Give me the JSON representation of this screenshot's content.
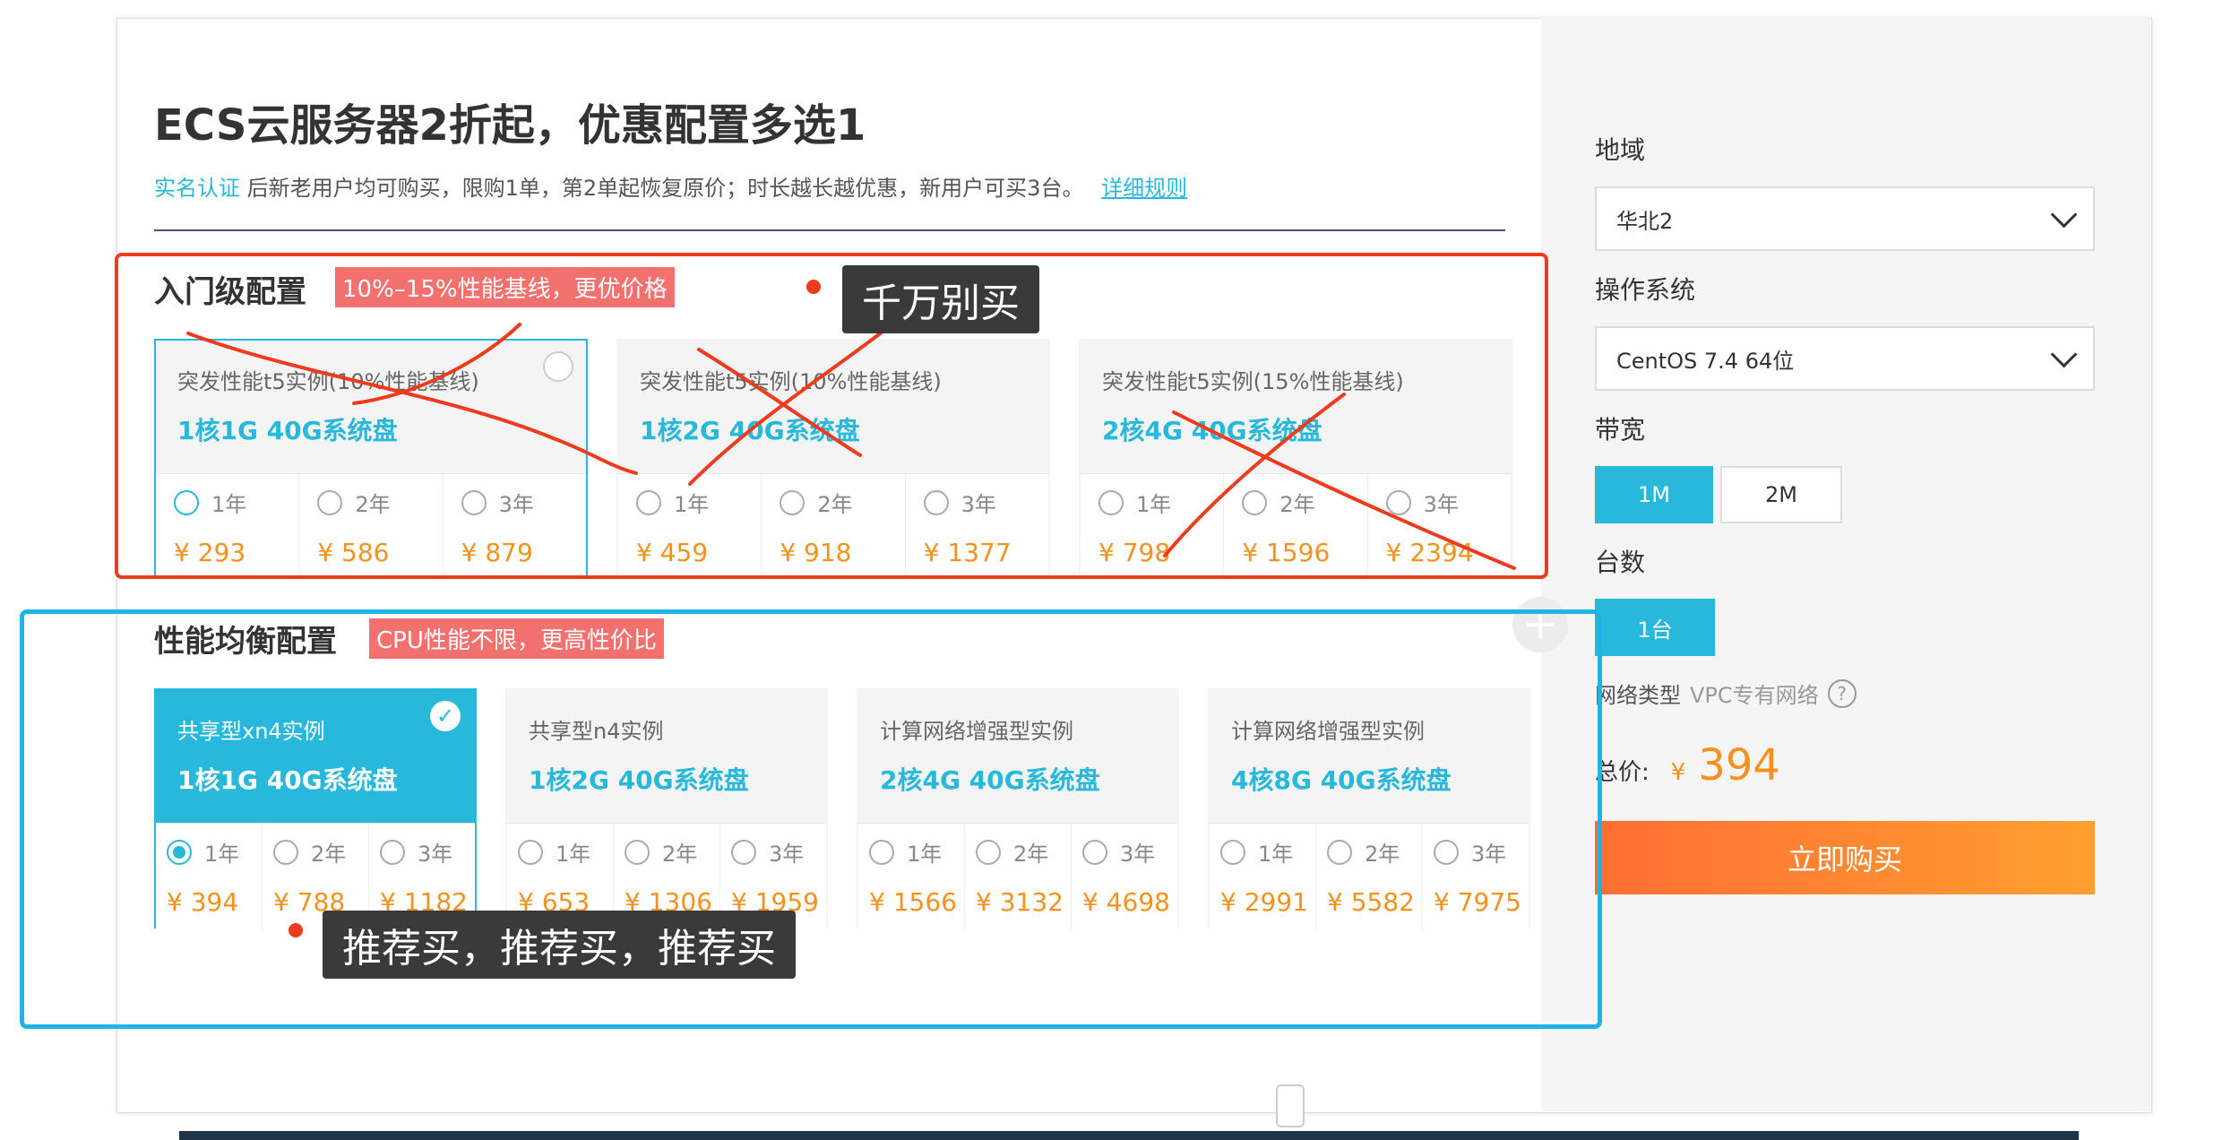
{
  "header": {
    "title": "ECS云服务器2折起，优惠配置多选1",
    "sub_blue": "实名认证",
    "sub_text": "后新老用户均可购买，限购1单，第2单起恢复原价；时长越长越优惠，新用户可买3台。",
    "sub_link": "详细规则"
  },
  "entry": {
    "title": "入门级配置",
    "badge": "10%–15%性能基线，更优价格",
    "plans": [
      {
        "name": "突发性能t5实例(10%性能基线)",
        "spec": "1核1G 40G系统盘",
        "opts": [
          {
            "y": "1年",
            "p": "¥ 293"
          },
          {
            "y": "2年",
            "p": "¥ 586"
          },
          {
            "y": "3年",
            "p": "¥ 879"
          }
        ]
      },
      {
        "name": "突发性能t5实例(10%性能基线)",
        "spec": "1核2G 40G系统盘",
        "opts": [
          {
            "y": "1年",
            "p": "¥ 459"
          },
          {
            "y": "2年",
            "p": "¥ 918"
          },
          {
            "y": "3年",
            "p": "¥ 1377"
          }
        ]
      },
      {
        "name": "突发性能t5实例(15%性能基线)",
        "spec": "2核4G 40G系统盘",
        "opts": [
          {
            "y": "1年",
            "p": "¥ 798"
          },
          {
            "y": "2年",
            "p": "¥ 1596"
          },
          {
            "y": "3年",
            "p": "¥ 2394"
          }
        ]
      }
    ]
  },
  "balanced": {
    "title": "性能均衡配置",
    "badge": "CPU性能不限，更高性价比",
    "plans": [
      {
        "name": "共享型xn4实例",
        "spec": "1核1G 40G系统盘",
        "opts": [
          {
            "y": "1年",
            "p": "¥ 394"
          },
          {
            "y": "2年",
            "p": "¥ 788"
          },
          {
            "y": "3年",
            "p": "¥ 1182"
          }
        ]
      },
      {
        "name": "共享型n4实例",
        "spec": "1核2G 40G系统盘",
        "opts": [
          {
            "y": "1年",
            "p": "¥ 653"
          },
          {
            "y": "2年",
            "p": "¥ 1306"
          },
          {
            "y": "3年",
            "p": "¥ 1959"
          }
        ]
      },
      {
        "name": "计算网络增强型实例",
        "spec": "2核4G 40G系统盘",
        "opts": [
          {
            "y": "1年",
            "p": "¥ 1566"
          },
          {
            "y": "2年",
            "p": "¥ 3132"
          },
          {
            "y": "3年",
            "p": "¥ 4698"
          }
        ]
      },
      {
        "name": "计算网络增强型实例",
        "spec": "4核8G 40G系统盘",
        "opts": [
          {
            "y": "1年",
            "p": "¥ 2991"
          },
          {
            "y": "2年",
            "p": "¥ 5582"
          },
          {
            "y": "3年",
            "p": "¥ 7975"
          }
        ]
      }
    ]
  },
  "side": {
    "region_label": "地域",
    "region_value": "华北2",
    "os_label": "操作系统",
    "os_value": "CentOS 7.4 64位",
    "bw_label": "带宽",
    "bw_opt1": "1M",
    "bw_opt2": "2M",
    "qty_label": "台数",
    "qty_opt": "1台",
    "net_label": "网络类型",
    "net_value": "VPC专有网络",
    "total_label": "总价:",
    "currency": "¥",
    "total_value": "394",
    "buy_label": "立即购买"
  },
  "annotations": {
    "dont_buy": "千万别买",
    "recommend": "推荐买，推荐买，推荐买"
  },
  "colors": {
    "accent": "#27b8dc",
    "price": "#f6911e",
    "badge": "#f2706e",
    "red_mark": "#ef3b1d",
    "blue_mark": "#1fb3e6"
  }
}
